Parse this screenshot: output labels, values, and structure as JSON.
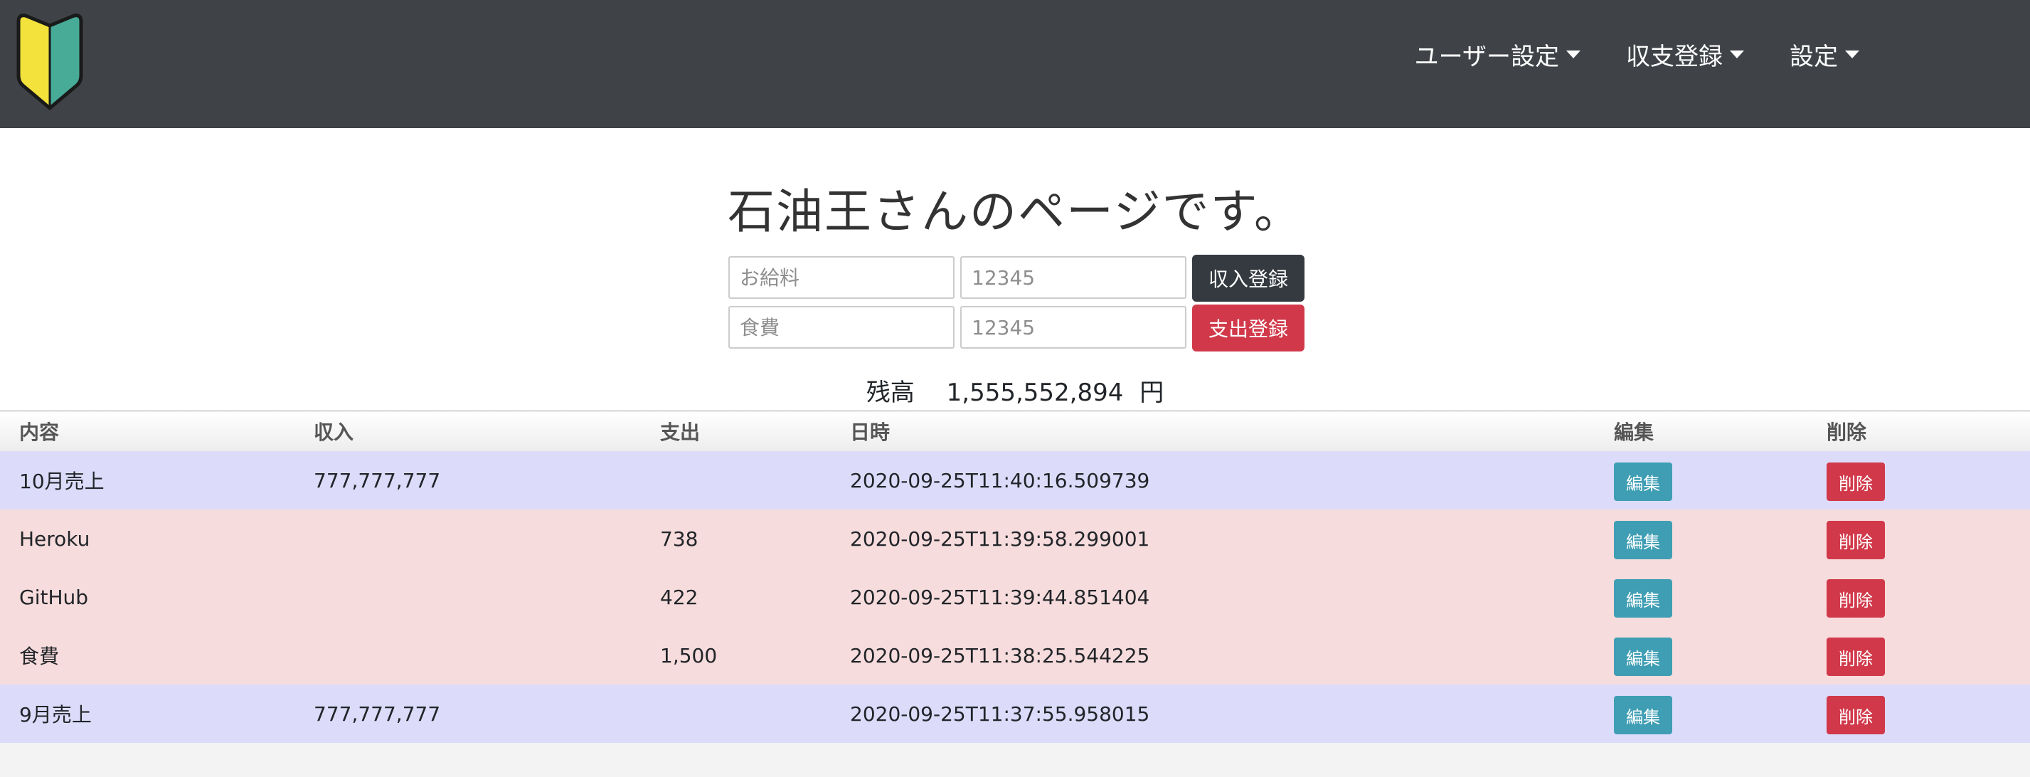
{
  "nav": {
    "items": [
      {
        "label": "ユーザー設定"
      },
      {
        "label": "収支登録"
      },
      {
        "label": "設定"
      }
    ]
  },
  "page": {
    "title": "石油王さんのページです。"
  },
  "form": {
    "income": {
      "name_placeholder": "お給料",
      "amount_placeholder": "12345",
      "button_label": "収入登録"
    },
    "expense": {
      "name_placeholder": "食費",
      "amount_placeholder": "12345",
      "button_label": "支出登録"
    }
  },
  "balance": {
    "label": "残高",
    "value": "1,555,552,894",
    "unit": "円"
  },
  "table": {
    "headers": [
      "内容",
      "収入",
      "支出",
      "日時",
      "編集",
      "削除"
    ],
    "edit_label": "編集",
    "delete_label": "削除",
    "rows": [
      {
        "type": "income",
        "content": "10月売上",
        "income": "777,777,777",
        "expense": "",
        "datetime": "2020-09-25T11:40:16.509739"
      },
      {
        "type": "expense",
        "content": "Heroku",
        "income": "",
        "expense": "738",
        "datetime": "2020-09-25T11:39:58.299001"
      },
      {
        "type": "expense",
        "content": "GitHub",
        "income": "",
        "expense": "422",
        "datetime": "2020-09-25T11:39:44.851404"
      },
      {
        "type": "expense",
        "content": "食費",
        "income": "",
        "expense": "1,500",
        "datetime": "2020-09-25T11:38:25.544225"
      },
      {
        "type": "income",
        "content": "9月売上",
        "income": "777,777,777",
        "expense": "",
        "datetime": "2020-09-25T11:37:55.958015"
      }
    ]
  },
  "colors": {
    "navbar": "#3f4347",
    "income_row": "#dcdcfa",
    "expense_row": "#f7dcdd",
    "edit_button": "#3f9eb4",
    "delete_button": "#d1394a",
    "income_button": "#343a40"
  },
  "icons": {
    "logo": "beginner-driver-mark-icon",
    "dropdown": "caret-down-icon"
  }
}
